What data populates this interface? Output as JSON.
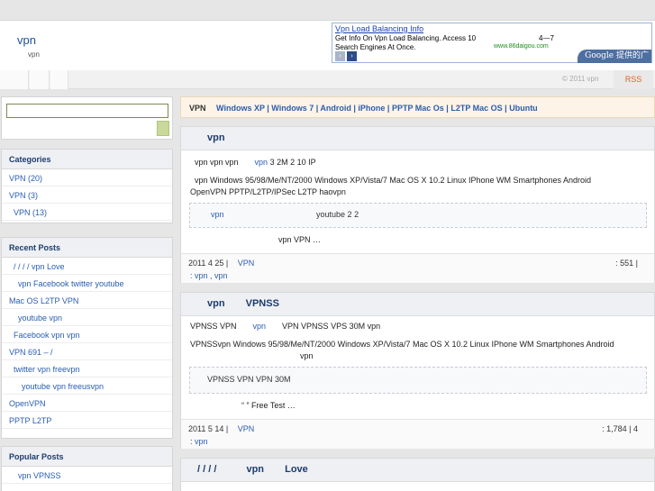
{
  "header": {
    "site_title": "vpn",
    "site_desc": "vpn"
  },
  "ad": {
    "title": "Vpn Load Balancing Info",
    "line1": "Get Info On Vpn Load Balancing. Access 10",
    "line2": "Search Engines At Once.",
    "mid": "4—7",
    "url": "www.86daigou.com",
    "google": "Google 提供的广告",
    "prev": "‹",
    "next": "›"
  },
  "navbar": {
    "copyright": "© 2011  vpn",
    "rss": "RSS"
  },
  "sidebar": {
    "search_placeholder": "",
    "categories_title": "Categories",
    "categories": [
      "VPN  (20)",
      "VPN  (3)",
      "VPN (13)"
    ],
    "recent_title": "Recent Posts",
    "recent": [
      "/ / / /      vpn      Love",
      "vpn      Facebook twitter youtube",
      "Mac OS L2TP    VPN",
      "youtube        vpn",
      "Facebook        vpn        vpn",
      "VPN  691 –              /",
      "twitter     vpn     freevpn",
      "youtube        vpn      freeusvpn",
      "OpenVPN",
      "PPTP L2TP"
    ],
    "popular_title": "Popular Posts",
    "popular": [
      "vpn      VPNSS"
    ]
  },
  "catbar": {
    "label": "VPN",
    "links": [
      "Windows XP | Windows 7 | Android | iPhone | PPTP Mac Os | L2TP Mac OS | Ubuntu"
    ]
  },
  "posts": [
    {
      "title": "vpn",
      "line1a": "vpn          vpn          vpn",
      "line1link": "vpn",
      "line1b": "3       2M          2             10 IP",
      "line2": "vpn  Windows 95/98/Me/NT/2000 Windows XP/Vista/7 Mac OS X 10.2       Linux IPhone WM Smartphones Android",
      "line3": "OpenVPN      PPTP/L2TP/IPSec    L2TP      haovpn",
      "quote_link": "vpn",
      "quote_text": "youtube           2                                      2",
      "more": "vpn                    VPN          …",
      "foot_date": "2011 4 25 |",
      "foot_cat": "VPN",
      "foot_count": ": 551 |",
      "foot_tags_prefix": ": vpn ,",
      "foot_tag2": "vpn"
    },
    {
      "title1": "vpn",
      "title2": "VPNSS",
      "line1a": "VPNSS        VPN",
      "line1link": "vpn",
      "line1b": "VPN VPNSS     VPS                        30M       vpn",
      "line2": "VPNSSvpn  Windows 95/98/Me/NT/2000 Windows XP/Vista/7 Mac OS X 10.2       Linux IPhone WM Smartphones Android",
      "line3": "vpn",
      "quote_text": "VPNSS    VPN          VPN                                       30M",
      "more": "“  ”         Free Test                        …",
      "foot_date": "2011 5 14 |",
      "foot_cat": "VPN",
      "foot_count": ": 1,784 | 4",
      "foot_tags_prefix": ":",
      "foot_tag2": "vpn"
    },
    {
      "title1": "/   /   /   /",
      "title2": "vpn",
      "title3": "Love"
    }
  ]
}
